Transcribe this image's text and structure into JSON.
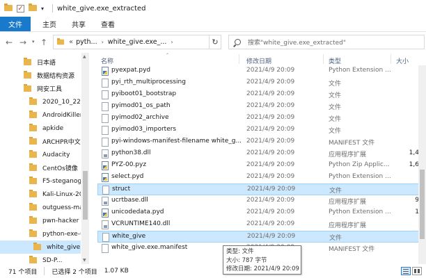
{
  "window": {
    "title": "white_give.exe_extracted"
  },
  "ribbon": {
    "tabs": [
      "文件",
      "主页",
      "共享",
      "查看"
    ]
  },
  "address": {
    "prefix": "«",
    "crumbs": [
      "pyth...",
      "white_give.exe_..."
    ],
    "search_placeholder": "搜索\"white_give.exe_extracted\""
  },
  "nav": {
    "items": [
      {
        "label": "日本語",
        "indent": 1
      },
      {
        "label": "数据结构资源",
        "indent": 1
      },
      {
        "label": "网安工具",
        "indent": 1
      },
      {
        "label": "2020_10_22",
        "indent": 2
      },
      {
        "label": "AndroidKiller",
        "indent": 2
      },
      {
        "label": "apkide",
        "indent": 2
      },
      {
        "label": "ARCHPR中文",
        "indent": 2
      },
      {
        "label": "Audacity",
        "indent": 2
      },
      {
        "label": "CentOs镜像",
        "indent": 2
      },
      {
        "label": "F5-steganogr",
        "indent": 2
      },
      {
        "label": "Kali-Linux-20",
        "indent": 2
      },
      {
        "label": "outguess-ma",
        "indent": 2
      },
      {
        "label": "pwn-hacker",
        "indent": 2
      },
      {
        "label": "python-exe-u",
        "indent": 2
      },
      {
        "label": "white_give.e",
        "indent": 3,
        "selected": true
      },
      {
        "label": "SD-P...",
        "indent": 2
      }
    ]
  },
  "columns": {
    "name": "名称",
    "date": "修改日期",
    "type": "类型",
    "size": "大小"
  },
  "files": [
    {
      "name": "pyexpat.pyd",
      "date": "2021/4/9 20:09",
      "type": "Python Extension ...",
      "size": "",
      "icon": "py"
    },
    {
      "name": "pyi_rth_multiprocessing",
      "date": "2021/4/9 20:09",
      "type": "文件",
      "size": "",
      "icon": "file"
    },
    {
      "name": "pyiboot01_bootstrap",
      "date": "2021/4/9 20:09",
      "type": "文件",
      "size": "",
      "icon": "file"
    },
    {
      "name": "pyimod01_os_path",
      "date": "2021/4/9 20:09",
      "type": "文件",
      "size": "",
      "icon": "file"
    },
    {
      "name": "pyimod02_archive",
      "date": "2021/4/9 20:09",
      "type": "文件",
      "size": "",
      "icon": "file"
    },
    {
      "name": "pyimod03_importers",
      "date": "2021/4/9 20:09",
      "type": "文件",
      "size": "",
      "icon": "file"
    },
    {
      "name": "pyi-windows-manifest-filename white_g...",
      "date": "2021/4/9 20:09",
      "type": "MANIFEST 文件",
      "size": "",
      "icon": "file"
    },
    {
      "name": "python38.dll",
      "date": "2021/4/9 20:09",
      "type": "应用程序扩展",
      "size": "1,4",
      "icon": "dll"
    },
    {
      "name": "PYZ-00.pyz",
      "date": "2021/4/9 20:09",
      "type": "Python Zip Applic...",
      "size": "1,6",
      "icon": "py"
    },
    {
      "name": "select.pyd",
      "date": "2021/4/9 20:09",
      "type": "Python Extension ...",
      "size": "",
      "icon": "py"
    },
    {
      "name": "struct",
      "date": "2021/4/9 20:09",
      "type": "文件",
      "size": "",
      "icon": "file",
      "selected": true
    },
    {
      "name": "ucrtbase.dll",
      "date": "2021/4/9 20:09",
      "type": "应用程序扩展",
      "size": "9",
      "icon": "dll"
    },
    {
      "name": "unicodedata.pyd",
      "date": "2021/4/9 20:09",
      "type": "Python Extension ...",
      "size": "1",
      "icon": "py"
    },
    {
      "name": "VCRUNTIME140.dll",
      "date": "2021/4/9 20:09",
      "type": "应用程序扩展",
      "size": "",
      "icon": "dll"
    },
    {
      "name": "white_give",
      "date": "2021/4/9 20:09",
      "type": "文件",
      "size": "",
      "icon": "file",
      "selected": true
    },
    {
      "name": "white_give.exe.manifest",
      "date": "2021/4/9 20:09",
      "type": "MANIFEST 文件",
      "size": "",
      "icon": "file"
    }
  ],
  "tooltip": {
    "line1": "类型: 文件",
    "line2": "大小: 787 字节",
    "line3": "修改日期: 2021/4/9 20:09"
  },
  "status": {
    "count": "71 个项目",
    "selected": "已选择 2 个项目",
    "size": "1.07 KB"
  },
  "colors": {
    "accent": "#1979ca",
    "selection": "#cce8ff",
    "folder": "#e8b64c"
  }
}
